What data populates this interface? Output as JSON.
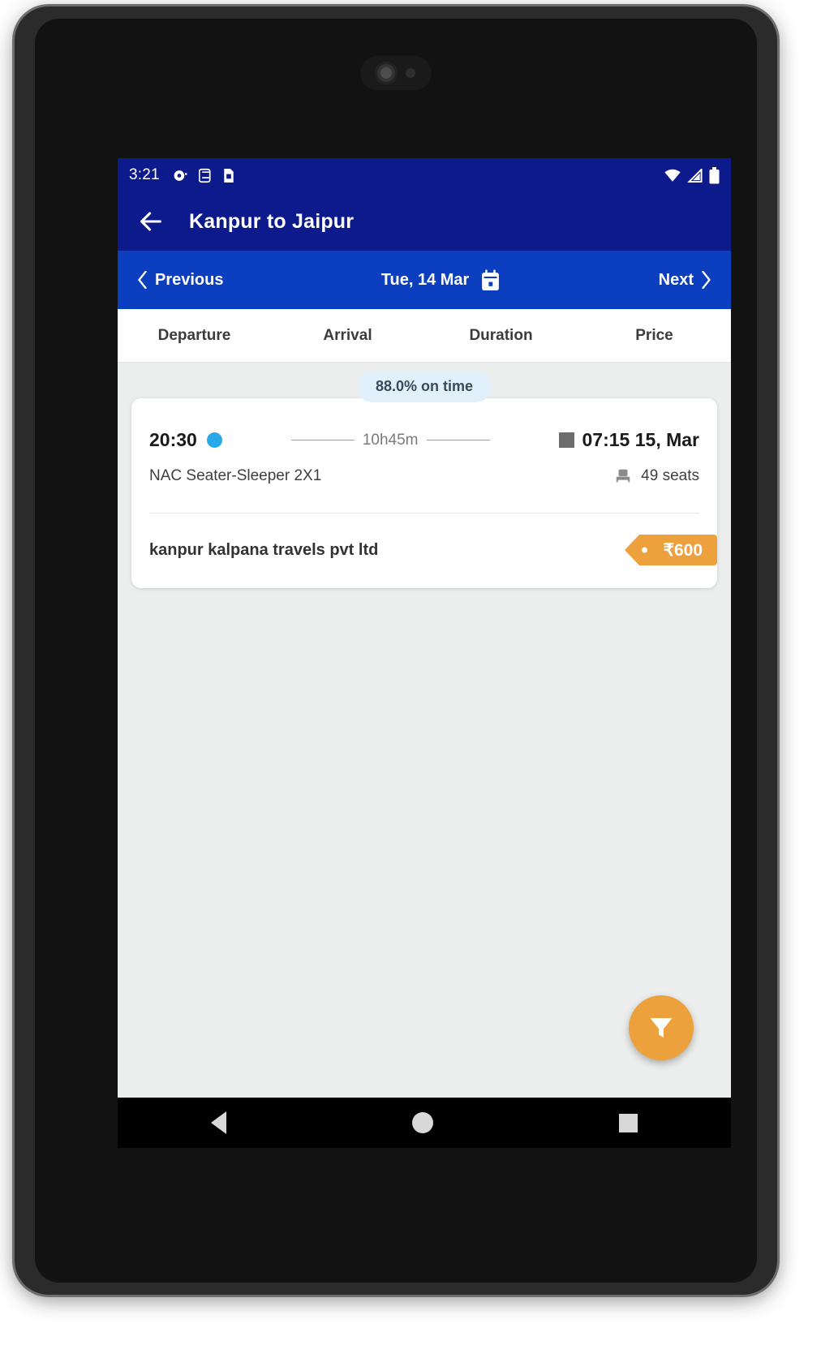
{
  "status_bar": {
    "time": "3:21",
    "left_icons": [
      "notification-icon",
      "sd-card-icon",
      "sim-icon"
    ],
    "right_icons": [
      "wifi-icon",
      "signal-icon",
      "battery-icon"
    ]
  },
  "app_bar": {
    "back_icon": "back-arrow-icon",
    "title": "Kanpur to Jaipur"
  },
  "date_nav": {
    "previous_label": "Previous",
    "date_label": "Tue, 14 Mar",
    "calendar_icon": "calendar-icon",
    "next_label": "Next"
  },
  "sort_tabs": [
    {
      "label": "Departure"
    },
    {
      "label": "Arrival"
    },
    {
      "label": "Duration"
    },
    {
      "label": "Price"
    }
  ],
  "results": [
    {
      "on_time_badge": "88.0% on time",
      "departure_time": "20:30",
      "duration": "10h45m",
      "arrival_time": "07:15 15, Mar",
      "bus_type": "NAC Seater-Sleeper 2X1",
      "seats_available": "49 seats",
      "seat_icon": "seat-icon",
      "operator": "kanpur kalpana travels pvt ltd",
      "price": "₹600"
    }
  ],
  "filter_fab": {
    "icon": "filter-funnel-icon",
    "color": "#eda13c"
  },
  "navigation_bar": {
    "back_icon": "android-back-icon",
    "home_icon": "android-home-icon",
    "recents_icon": "android-recents-icon"
  },
  "colors": {
    "status_bar": "#0d1a8c",
    "app_bar": "#0d1a8c",
    "date_nav": "#0b3fbf",
    "accent_orange": "#eda13c",
    "badge_bg": "#e1f0fb",
    "page_bg": "#eceded"
  }
}
